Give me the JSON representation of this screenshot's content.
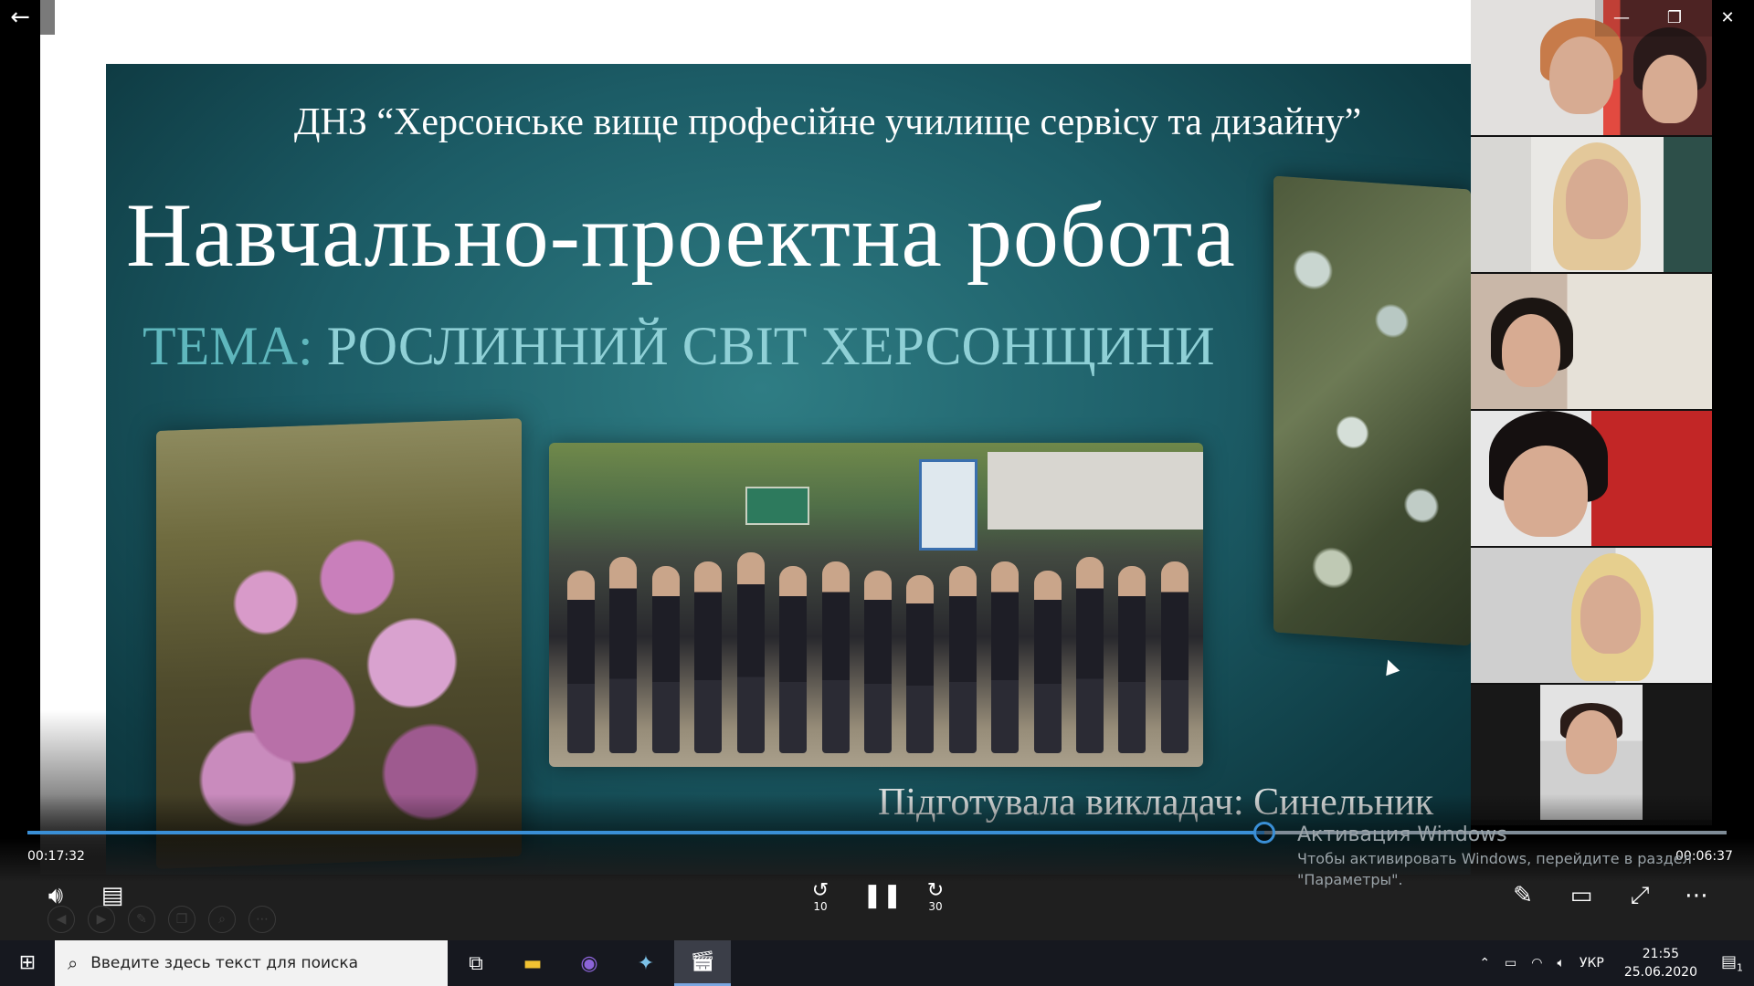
{
  "slide": {
    "org_title": "ДНЗ “Херсонське вище професійне училище сервісу та дизайну”",
    "main_title": "Навчально-проектна робота",
    "topic_label": "ТЕМА: ",
    "topic_value": "РОСЛИННИЙ СВІТ ХЕРСОНЩИНИ",
    "author": "Підготувала викладач: Синельник"
  },
  "player": {
    "time_elapsed": "00:17:32",
    "time_remaining": "00:06:37",
    "progress_fraction": 0.728,
    "skip_back_label": "10",
    "skip_forward_label": "30"
  },
  "activation": {
    "title": "Активация Windows",
    "line1": "Чтобы активировать Windows, перейдите в раздел",
    "line2": "\"Параметры\"."
  },
  "taskbar": {
    "search_placeholder": "Введите здесь текст для поиска",
    "lang": "УКР",
    "time": "21:55",
    "date": "25.06.2020",
    "notif_count": "1"
  },
  "colors": {
    "accent": "#3a8fd6",
    "slide_bg": "#1c5c66",
    "topic": "#5fb7bd"
  }
}
